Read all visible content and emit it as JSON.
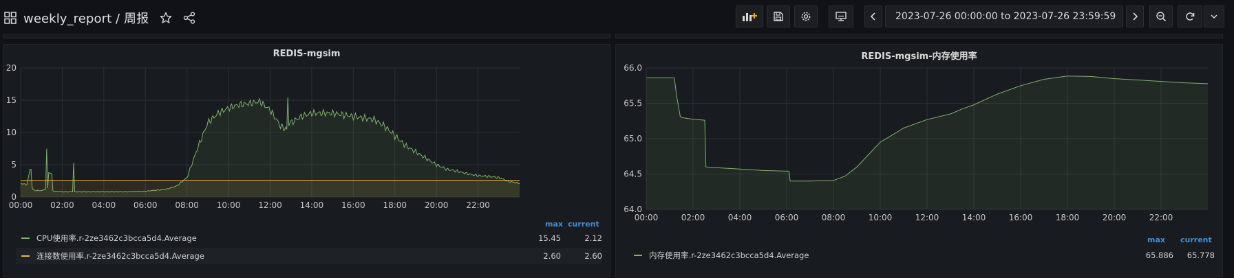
{
  "dashboard": {
    "title": "weekly_report / 周报",
    "time_range": "2023-07-26 00:00:00 to 2023-07-26 23:59:59"
  },
  "toolbar": {
    "icons": [
      "add-panel-icon",
      "save-icon",
      "settings-icon",
      "tv-mode-icon",
      "time-back-icon",
      "clock-icon",
      "chevron-down-icon",
      "time-forward-icon",
      "zoom-out-icon",
      "refresh-icon",
      "chevron-down-icon"
    ]
  },
  "colors": {
    "cpu": "#7eb26d",
    "conn": "#eab839",
    "mem": "#7eb26d",
    "legend_header": "#3d8fd9"
  },
  "panel_left": {
    "title": "REDIS-mgsim",
    "legend_header": {
      "max": "max",
      "current": "current"
    },
    "legend": [
      {
        "name": "CPU使用率.r-2ze3462c3bcca5d4.Average",
        "max": "15.45",
        "current": "2.12"
      },
      {
        "name": "连接数使用率.r-2ze3462c3bcca5d4.Average",
        "max": "2.60",
        "current": "2.60"
      }
    ],
    "y_ticks": [
      "0",
      "5",
      "10",
      "15",
      "20"
    ],
    "x_ticks": [
      "00:00",
      "02:00",
      "04:00",
      "06:00",
      "08:00",
      "10:00",
      "12:00",
      "14:00",
      "16:00",
      "18:00",
      "20:00",
      "22:00"
    ]
  },
  "panel_right": {
    "title": "REDIS-mgsim-内存使用率",
    "legend_header": {
      "max": "max",
      "current": "current"
    },
    "legend": [
      {
        "name": "内存使用率.r-2ze3462c3bcca5d4.Average",
        "max": "65.886",
        "current": "65.778"
      }
    ],
    "y_ticks": [
      "64.0",
      "64.5",
      "65.0",
      "65.5",
      "66.0"
    ],
    "x_ticks": [
      "00:00",
      "02:00",
      "04:00",
      "06:00",
      "08:00",
      "10:00",
      "12:00",
      "14:00",
      "16:00",
      "18:00",
      "20:00",
      "22:00"
    ]
  },
  "chart_data": [
    {
      "type": "area",
      "title": "REDIS-mgsim",
      "x_unit": "hour",
      "xlim": [
        0,
        24
      ],
      "ylim": [
        0,
        20
      ],
      "grid": true,
      "legend_placement": "bottom",
      "series": [
        {
          "name": "CPU使用率.r-2ze3462c3bcca5d4.Average",
          "x": [
            0,
            0.3,
            0.45,
            0.5,
            0.55,
            0.6,
            0.7,
            1.0,
            1.2,
            1.25,
            1.3,
            1.35,
            1.5,
            1.55,
            1.6,
            2.0,
            2.5,
            2.55,
            2.6,
            3,
            4,
            5,
            6,
            7,
            7.5,
            8,
            8.5,
            9,
            9.5,
            10,
            10.5,
            11,
            11.5,
            12,
            12.5,
            12.8,
            12.85,
            12.9,
            13,
            13.5,
            14,
            15,
            16,
            17,
            17.5,
            18,
            18.5,
            19,
            19.5,
            20,
            20.5,
            21,
            21.5,
            22,
            22.5,
            23,
            23.5,
            24
          ],
          "y": [
            2.1,
            1.9,
            4.3,
            4.3,
            1.5,
            1.2,
            1.0,
            1.0,
            1.2,
            7.5,
            1.4,
            3.8,
            3.6,
            1.0,
            0.9,
            0.8,
            0.8,
            5.3,
            0.8,
            0.8,
            0.8,
            0.8,
            0.9,
            1.2,
            1.7,
            3.0,
            7.5,
            11.5,
            13.0,
            13.8,
            14.3,
            14.5,
            14.8,
            13.5,
            11.0,
            10.5,
            15.45,
            11.0,
            11.5,
            12.5,
            13.0,
            13.0,
            12.5,
            12.0,
            11.0,
            9.5,
            8.0,
            7.0,
            6.0,
            5.0,
            4.3,
            4.0,
            3.6,
            3.3,
            3.2,
            3.0,
            2.4,
            2.12
          ]
        },
        {
          "name": "连接数使用率.r-2ze3462c3bcca5d4.Average",
          "x": [
            0,
            24
          ],
          "y": [
            2.6,
            2.6
          ]
        }
      ]
    },
    {
      "type": "area",
      "title": "REDIS-mgsim-内存使用率",
      "x_unit": "hour",
      "xlim": [
        0,
        24
      ],
      "ylim": [
        64.0,
        66.0
      ],
      "grid": true,
      "legend_placement": "bottom",
      "series": [
        {
          "name": "内存使用率.r-2ze3462c3bcca5d4.Average",
          "x": [
            0,
            1.2,
            1.3,
            1.45,
            1.5,
            1.9,
            2.5,
            2.55,
            3,
            4,
            5,
            6.1,
            6.15,
            7,
            8,
            8.5,
            9,
            10,
            10.5,
            11,
            12,
            13,
            13.5,
            14,
            15,
            16,
            17,
            18,
            19,
            20,
            21,
            22,
            23,
            24
          ],
          "y": [
            65.86,
            65.86,
            65.6,
            65.32,
            65.3,
            65.28,
            65.26,
            64.6,
            64.59,
            64.57,
            64.55,
            64.54,
            64.4,
            64.4,
            64.41,
            64.47,
            64.6,
            64.95,
            65.05,
            65.15,
            65.27,
            65.35,
            65.42,
            65.48,
            65.63,
            65.75,
            65.84,
            65.886,
            65.88,
            65.85,
            65.83,
            65.81,
            65.79,
            65.778
          ]
        }
      ]
    }
  ]
}
